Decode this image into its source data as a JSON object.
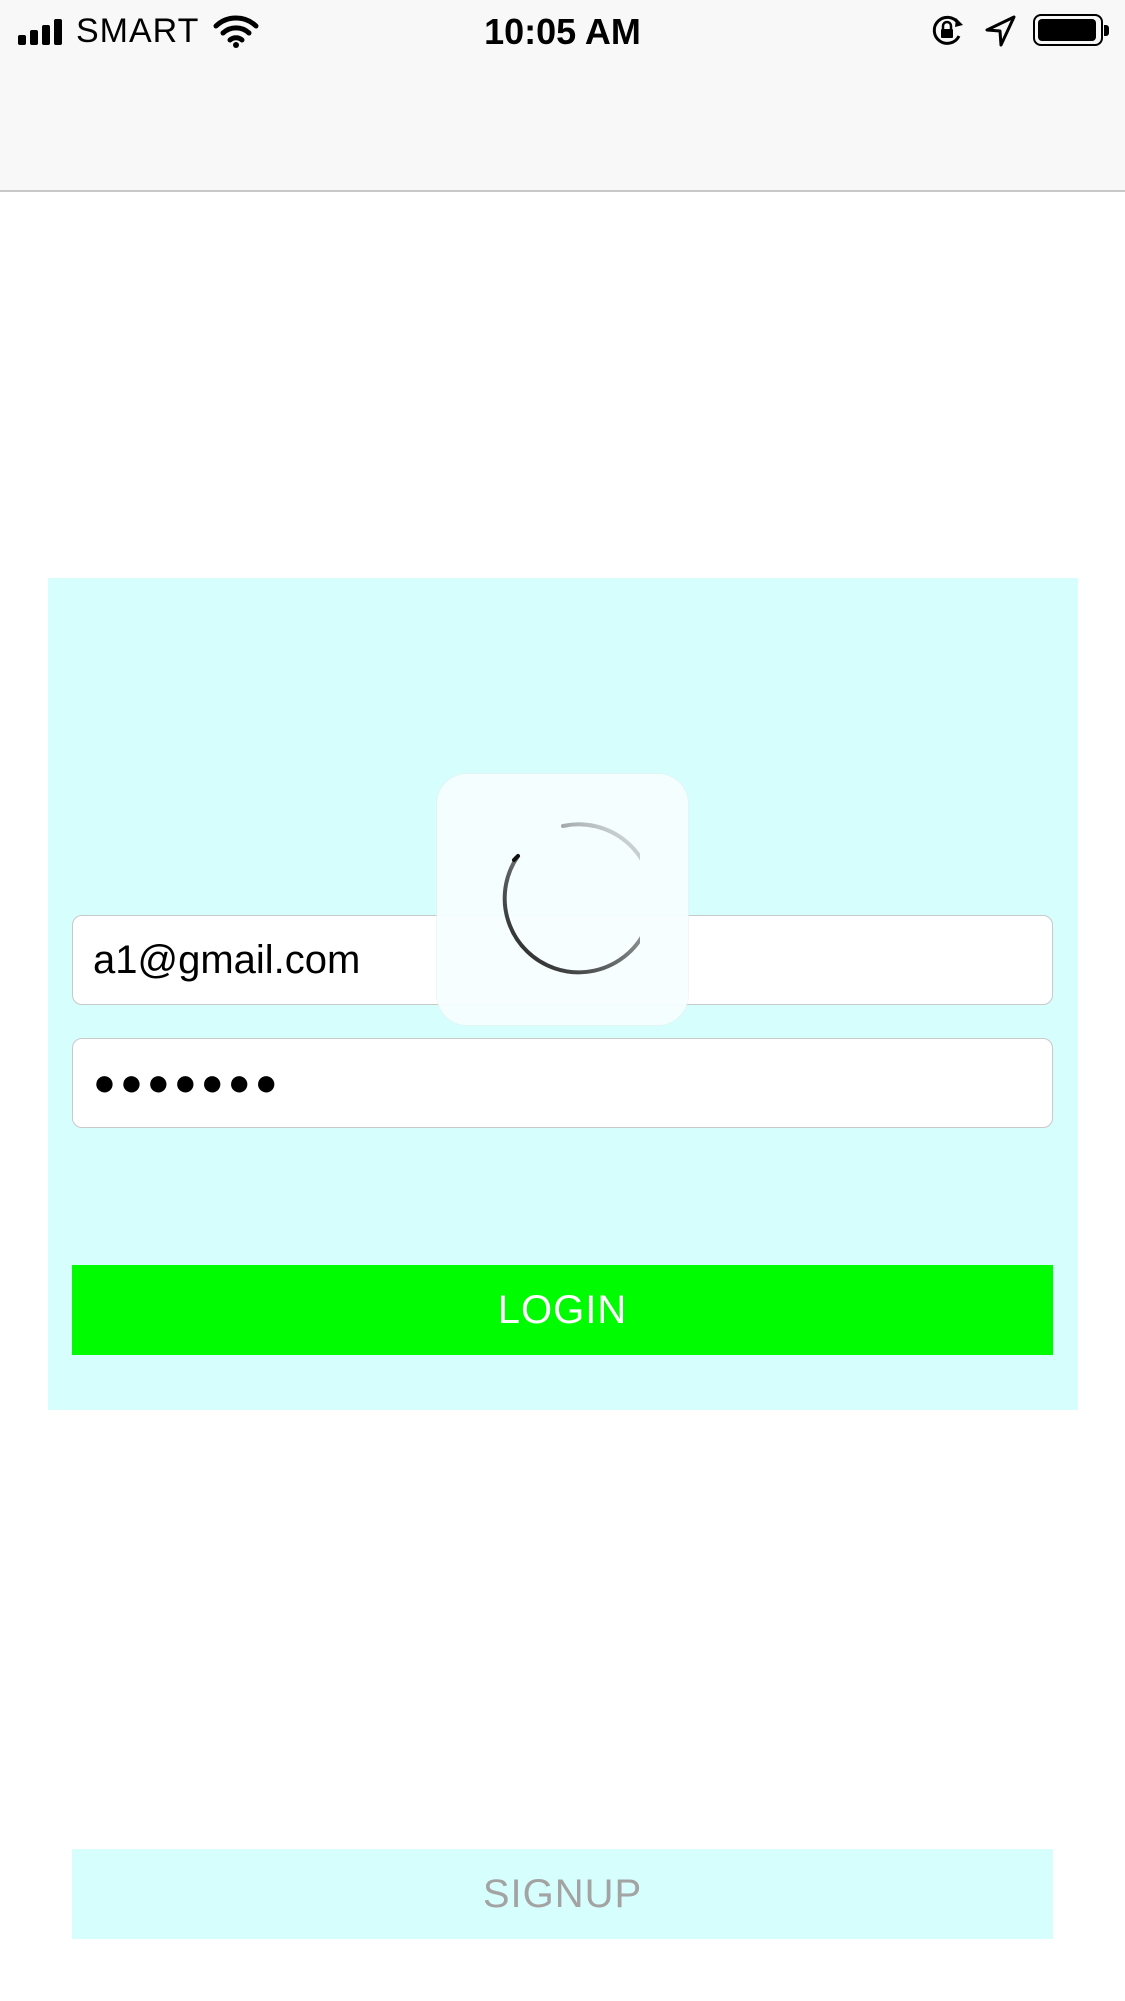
{
  "status_bar": {
    "carrier": "SMART",
    "time": "10:05 AM",
    "icons": [
      "signal-icon",
      "wifi-icon",
      "orientation-lock-icon",
      "location-arrow-icon",
      "battery-icon"
    ]
  },
  "login_form": {
    "email_value": "a1@gmail.com",
    "password_value": "●●●●●●●",
    "login_label": "LOGIN"
  },
  "loading": {
    "icon": "spinner-icon"
  },
  "signup_label": "SIGNUP",
  "colors": {
    "card_background": "#d6fefc",
    "login_button": "#00fc00",
    "signup_button": "#d6fefc",
    "signup_text": "#a3a3a3"
  }
}
